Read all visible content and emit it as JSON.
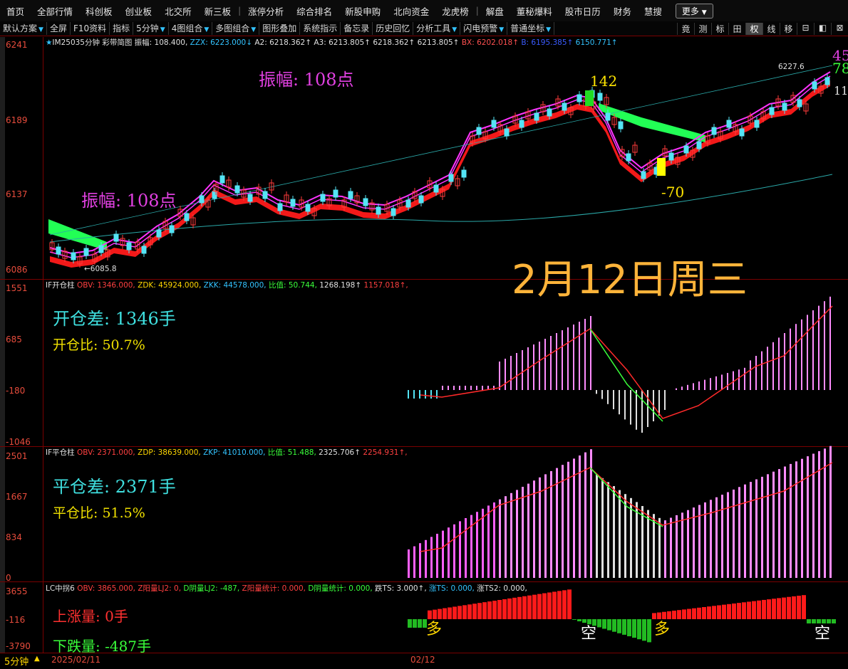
{
  "nav": {
    "items": [
      "首页",
      "全部行情",
      "科创板",
      "创业板",
      "北交所",
      "新三板",
      "涨停分析",
      "综合排名",
      "新股申购",
      "北向资金",
      "龙虎榜",
      "解盘",
      "董秘爆料",
      "股市日历",
      "财务",
      "慧搜"
    ],
    "more_label": "更多"
  },
  "toolbar": {
    "items": [
      "默认方案",
      "全屏",
      "F10资料",
      "指标",
      "5分钟",
      "4图组合",
      "多图组合",
      "图形叠加",
      "系统指示",
      "备忘录",
      "历史回忆",
      "分析工具",
      "闪电预警",
      "普通坐标"
    ],
    "right_buttons": [
      "竟",
      "测",
      "标",
      "田",
      "权",
      "线",
      "移"
    ],
    "active_right": "权"
  },
  "main_chart": {
    "legend_prefix": "IM25035分钟",
    "legend_name": "彩带简图",
    "zf_label": "振幅: 108.400,",
    "zzx": "ZZX: 6223.000↓",
    "a2": "A2: 6218.362↑",
    "a3": "A3: 6213.805↑",
    "a2b": "6218.362↑",
    "a3b": "6213.805↑",
    "bx": "BX: 6202.018↑",
    "b": "B: 6195.385↑",
    "c": "6150.771↑",
    "y_ticks": [
      "6241",
      "6189",
      "6137",
      "6086"
    ],
    "amp_top": "振幅: 108点",
    "amp_left": "振幅: 108点",
    "peak_label": "142",
    "trough_label": "-70",
    "low_price": "←6085.8",
    "high_price": "6227.6",
    "right_edge_labels": [
      "45",
      "78",
      "11"
    ],
    "date_banner": "2月12日周三"
  },
  "open_panel": {
    "title": "IF开仓柱",
    "obv": "OBV: 1346.000,",
    "zdk": "ZDK: 45924.000,",
    "zkk": "ZKK: 44578.000,",
    "ratio": "比值: 50.744,",
    "v1": "1268.198↑",
    "v2": "1157.018↑,",
    "y_ticks": [
      "1551",
      "685",
      "-180",
      "-1046"
    ],
    "diff_label": "开仓差: 1346手",
    "ratio_label": "开仓比: 50.7%"
  },
  "close_panel": {
    "title": "IF平仓柱",
    "obv": "OBV: 2371.000,",
    "zdp": "ZDP: 38639.000,",
    "zkp": "ZKP: 41010.000,",
    "ratio": "比值: 51.488,",
    "v1": "2325.706↑",
    "v2": "2254.931↑,",
    "y_ticks": [
      "2501",
      "1667",
      "834",
      "0"
    ],
    "diff_label": "平仓差: 2371手",
    "ratio_label": "平仓比: 51.5%"
  },
  "lc_panel": {
    "title": "LC中拐6",
    "obv": "OBV: 3865.000,",
    "zyl": "Z阳量LJ2: 0,",
    "dyl": "D阴量LJ2: -487,",
    "zyl_stat": "Z阳量统计: 0.000,",
    "dyl_stat": "D阴量统计: 0.000,",
    "dts": "跌TS: 3.000↑,",
    "zts": "涨TS: 0.000,",
    "zts2": "涨TS2: 0.000,",
    "y_ticks": [
      "3655",
      "-116",
      "-3790"
    ],
    "up_label": "上涨量: 0手",
    "down_label": "下跌量: -487手",
    "marks": [
      "多",
      "空",
      "多",
      "空"
    ]
  },
  "footer": {
    "period": "5分钟",
    "date1": "2025/02/11",
    "date2": "02/12"
  },
  "colors": {
    "up": "#ff3b3b",
    "down": "#54e4f5",
    "ribbon_red": "#ff1a1a",
    "ribbon_green": "#22ff55",
    "magenta": "#ff33ff",
    "banner": "#ffb43a"
  }
}
